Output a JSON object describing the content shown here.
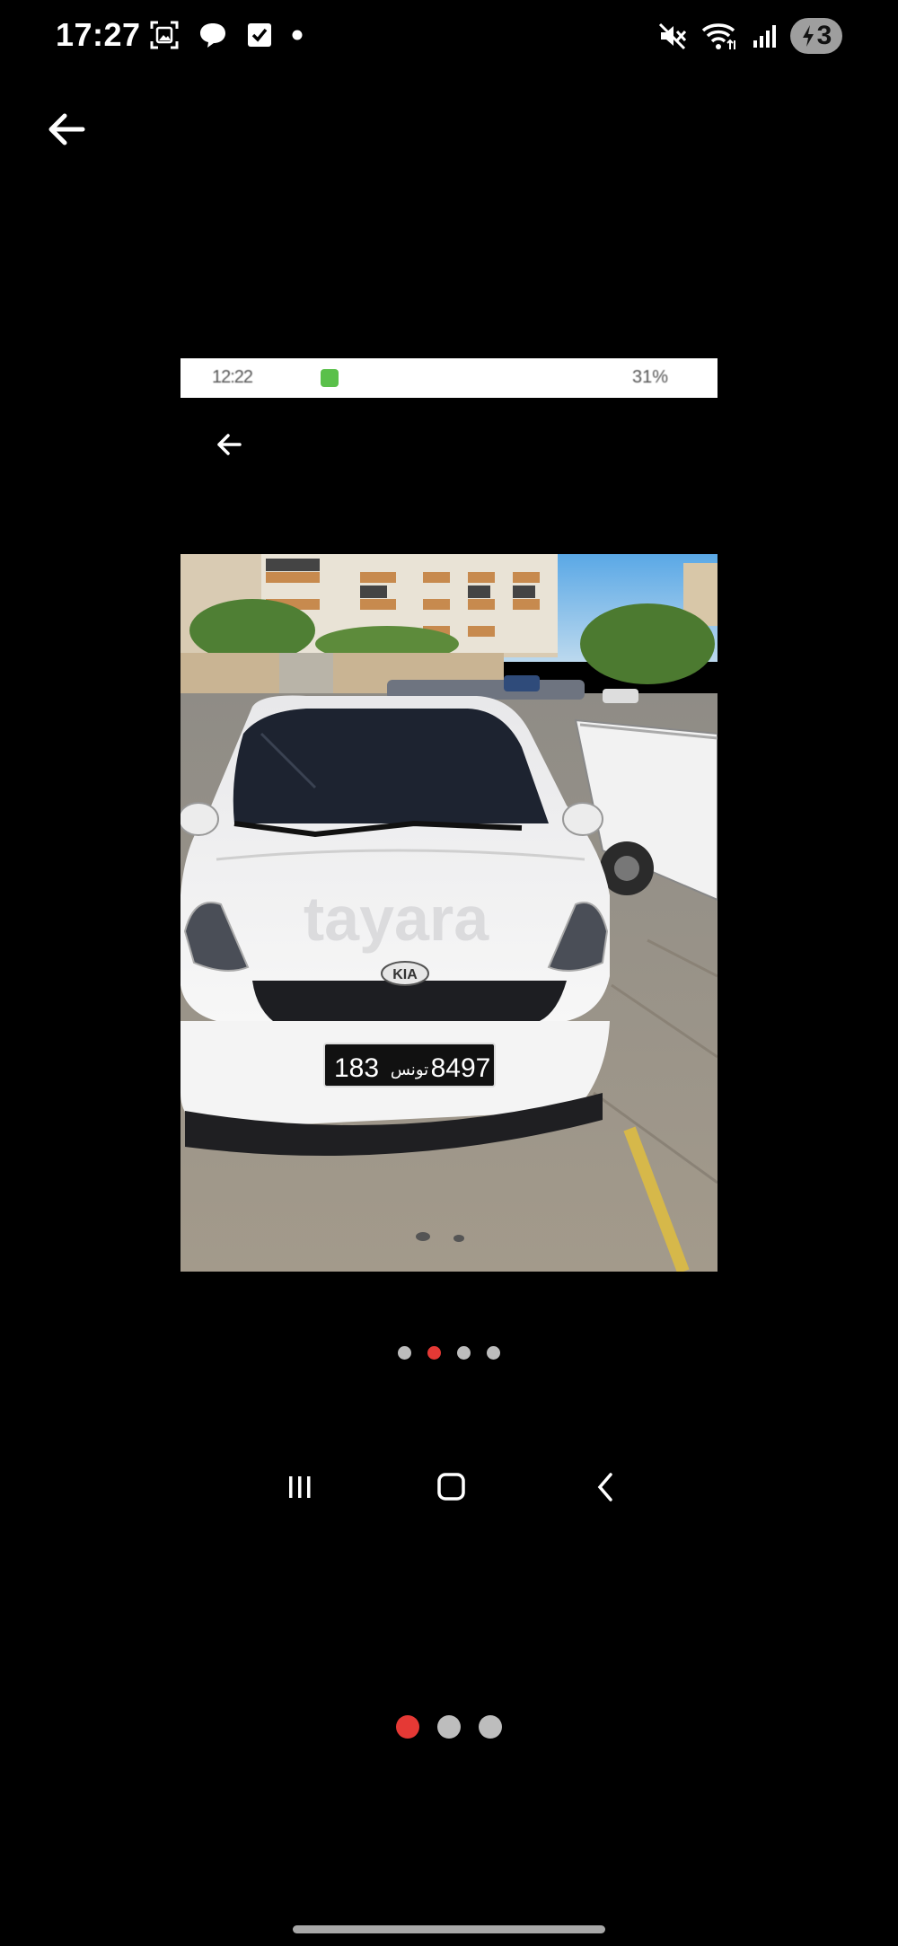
{
  "status_bar": {
    "time": "17:27",
    "battery_level": "3",
    "icons_left": [
      "screenshot-icon",
      "chat-bubble-icon",
      "checkbox-icon",
      "dot-icon"
    ],
    "icons_right": [
      "mute-icon",
      "wifi-icon",
      "signal-icon",
      "battery-charging-icon"
    ]
  },
  "viewer": {
    "image_count": 3,
    "active_index": 0
  },
  "inner_screenshot": {
    "status_time": "12:22",
    "status_battery": "31%",
    "photo": {
      "subject": "white car",
      "license_plate_left": "183",
      "license_plate_middle": "تونس",
      "license_plate_right": "8497",
      "watermark": "tayara"
    },
    "dots": {
      "count": 4,
      "active_index": 1
    },
    "nav": [
      "recents-icon",
      "home-icon",
      "back-icon"
    ]
  },
  "colors": {
    "background": "#000000",
    "accent_dot": "#e53935",
    "inactive_dot": "#bdbdbd"
  }
}
